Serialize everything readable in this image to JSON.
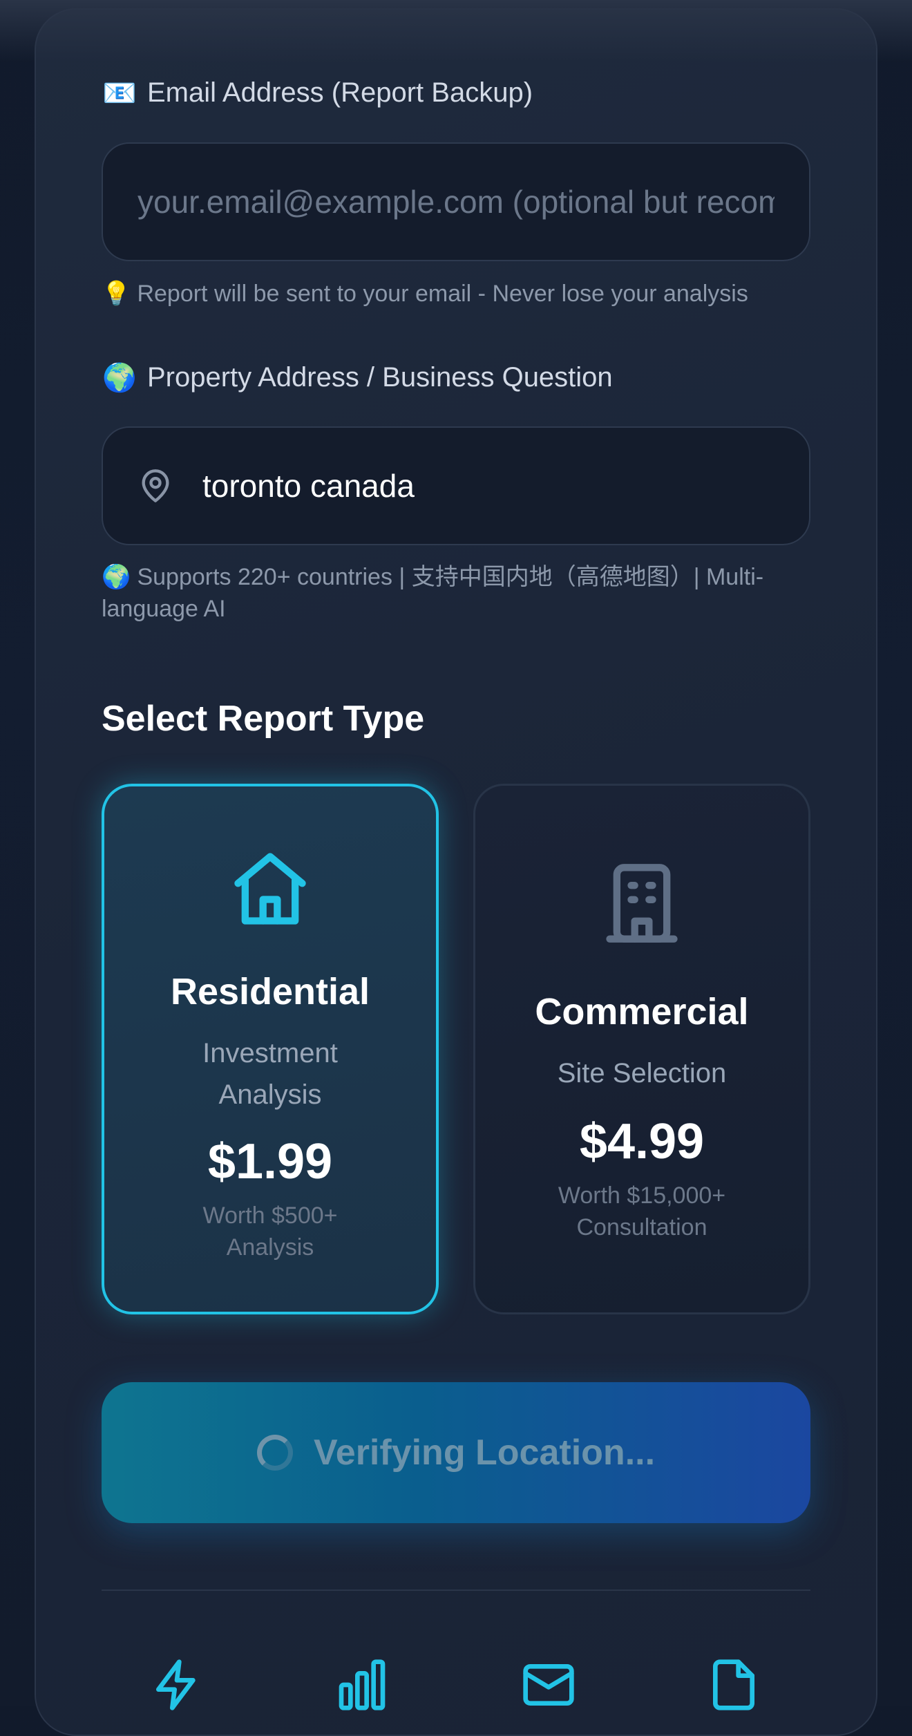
{
  "email": {
    "icon": "envelope-emoji",
    "emoji": "📧",
    "label": "Email Address (Report Backup)",
    "placeholder": "your.email@example.com (optional but recommended)",
    "value": "",
    "hint_emoji": "💡",
    "hint": "Report will be sent to your email - Never lose your analysis"
  },
  "property": {
    "icon": "globe-emoji",
    "emoji": "🌍",
    "label": "Property Address / Business Question",
    "value": "toronto canada",
    "hint_emoji": "🌍",
    "hint": "Supports 220+ countries | 支持中国内地（高德地图）| Multi-language AI"
  },
  "report_type": {
    "title": "Select Report Type",
    "options": [
      {
        "icon": "house-icon",
        "title": "Residential",
        "subtitle": "Investment Analysis",
        "price": "$1.99",
        "worth": "Worth $500+ Analysis",
        "selected": true
      },
      {
        "icon": "building-icon",
        "title": "Commercial",
        "subtitle": "Site Selection",
        "price": "$4.99",
        "worth": "Worth $15,000+ Consultation",
        "selected": false
      }
    ]
  },
  "submit": {
    "label": "Verifying Location...",
    "state": "loading"
  },
  "features": {
    "icons": [
      "lightning-icon",
      "bar-chart-icon",
      "mail-icon",
      "document-icon"
    ]
  },
  "colors": {
    "accent": "#22c3e6",
    "background": "#131d30",
    "card": "#1d2739",
    "cta_start": "#0e7590",
    "cta_end": "#1b47a0"
  }
}
